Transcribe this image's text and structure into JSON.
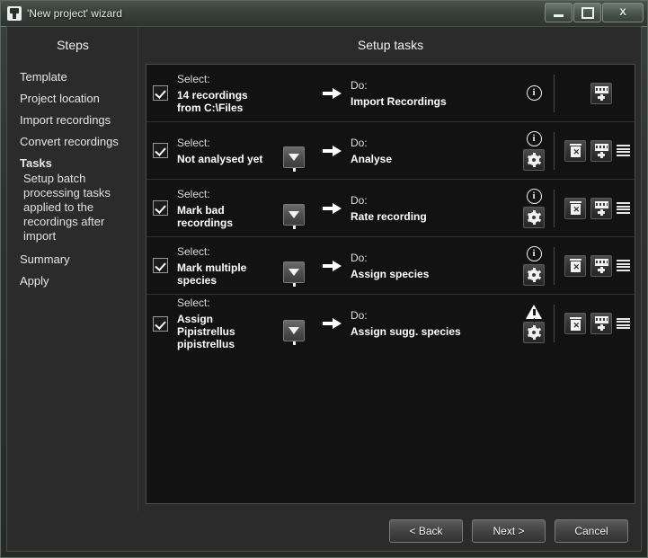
{
  "window": {
    "title": "'New project' wizard",
    "icon": "bat-detector-icon",
    "controls": {
      "minimize": "minimize-icon",
      "maximize": "maximize-icon",
      "close": "X"
    }
  },
  "sidebar": {
    "heading": "Steps",
    "items": [
      {
        "label": "Template",
        "current": false
      },
      {
        "label": "Project location",
        "current": false
      },
      {
        "label": "Import recordings",
        "current": false
      },
      {
        "label": "Convert recordings",
        "current": false
      },
      {
        "label": "Tasks",
        "current": true,
        "description": "Setup batch processing tasks applied to the recordings after import"
      },
      {
        "label": "Summary",
        "current": false
      },
      {
        "label": "Apply",
        "current": false
      }
    ]
  },
  "main": {
    "heading": "Setup tasks",
    "select_label": "Select:",
    "do_label": "Do:",
    "tasks": [
      {
        "checked": true,
        "select_value": "14 recordings from C:\\Files",
        "do_value": "Import Recordings",
        "has_filter": false,
        "status_icon": "info",
        "has_gear": false,
        "actions": [
          "add"
        ]
      },
      {
        "checked": true,
        "select_value": "Not analysed yet",
        "do_value": "Analyse",
        "has_filter": true,
        "status_icon": "info",
        "has_gear": true,
        "actions": [
          "delete",
          "add",
          "menu"
        ]
      },
      {
        "checked": true,
        "select_value": "Mark bad recordings",
        "do_value": "Rate recording",
        "has_filter": true,
        "status_icon": "info",
        "has_gear": true,
        "actions": [
          "delete",
          "add",
          "menu"
        ]
      },
      {
        "checked": true,
        "select_value": "Mark multiple species",
        "do_value": "Assign species",
        "has_filter": true,
        "status_icon": "info",
        "has_gear": true,
        "actions": [
          "delete",
          "add",
          "menu"
        ]
      },
      {
        "checked": true,
        "select_value": "Assign Pipistrellus pipistrellus",
        "do_value": "Assign sugg. species",
        "has_filter": true,
        "status_icon": "warning",
        "has_gear": true,
        "actions": [
          "delete",
          "add",
          "menu"
        ]
      }
    ]
  },
  "footer": {
    "back": "< Back",
    "next": "Next >",
    "cancel": "Cancel"
  },
  "colors": {
    "panel_bg": "#121212",
    "sidebar_bg": "#2b2b2b",
    "text": "#ffffff",
    "border": "#4d4d4d"
  }
}
